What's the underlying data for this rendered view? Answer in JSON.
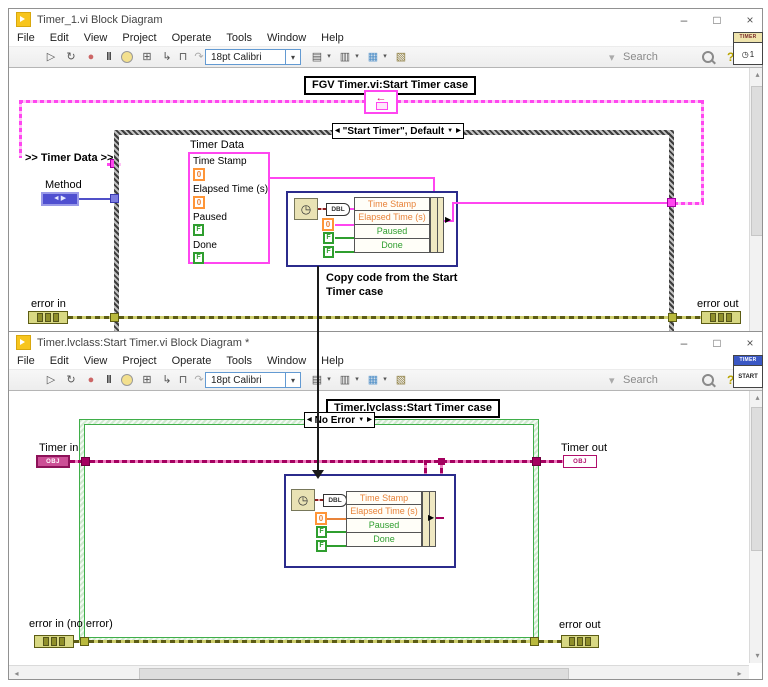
{
  "shared": {
    "menu": [
      "File",
      "Edit",
      "View",
      "Project",
      "Operate",
      "Tools",
      "Window",
      "Help"
    ],
    "font_selector": "18pt Calibri",
    "search_placeholder": "Search"
  },
  "icons": {
    "minimize": "–",
    "maximize": "□",
    "close": "×",
    "run": "▷",
    "run_continuous": "↻",
    "abort": "●",
    "pause": "‖",
    "highlight": "⊞",
    "step_into": "↳",
    "step_over": "⊓",
    "step_out": "↷",
    "align": "▤",
    "distribute": "▥",
    "resize": "▦",
    "reorder": "▧",
    "dropdown": "▾",
    "case_prev": "◀",
    "case_next": "▶",
    "case_drop": "▼",
    "feedback_arrow": "←",
    "scroll_up": "▴",
    "scroll_down": "▾",
    "scroll_left": "◂",
    "scroll_right": "▸",
    "clock": "◷",
    "help": "?"
  },
  "bundle": {
    "dbl": "DBL",
    "fields": [
      {
        "label": "Time Stamp"
      },
      {
        "label": "Elapsed Time (s)"
      },
      {
        "label": "Paused"
      },
      {
        "label": "Done"
      }
    ],
    "constants": {
      "elapsed": "0",
      "paused": "F",
      "done": "F"
    }
  },
  "win1": {
    "title": "Timer_1.vi Block Diagram",
    "vi_icon": {
      "header": "TIMER",
      "body": "1"
    },
    "diagram": {
      "heading": "FGV Timer.vi:Start Timer case",
      "case_selector": "\"Start Timer\", Default",
      "shift_label": ">> Timer Data >>",
      "method_label": "Method",
      "cluster": {
        "label": "Timer Data",
        "fields": [
          {
            "name": "Time Stamp",
            "value": "0"
          },
          {
            "name": "Elapsed Time (s)",
            "value": "0"
          },
          {
            "name": "Paused",
            "value": "F"
          },
          {
            "name": "Done",
            "value": "F"
          }
        ]
      },
      "annotation_line1": "Copy code from the Start",
      "annotation_line2": "Timer case",
      "error_in": "error in",
      "error_out": "error out"
    }
  },
  "win2": {
    "title": "Timer.lvclass:Start Timer.vi Block Diagram *",
    "vi_icon": {
      "header": "TIMER",
      "body": "START"
    },
    "diagram": {
      "heading": "Timer.lvclass:Start Timer case",
      "case_selector": "No Error",
      "timer_in": "Timer in",
      "timer_out": "Timer out",
      "obj": "OBJ",
      "error_in": "error in (no error)",
      "error_out": "error out"
    }
  },
  "colors": {
    "cluster_magenta": "#ff46f0",
    "class_wire": "#a4005f",
    "error_olive": "#5c5c14",
    "numeric_orange": "#ff9537",
    "boolean_green": "#2f9e2f",
    "structure_navy": "#2b2b8c",
    "error_case_green": "#3fae49"
  }
}
